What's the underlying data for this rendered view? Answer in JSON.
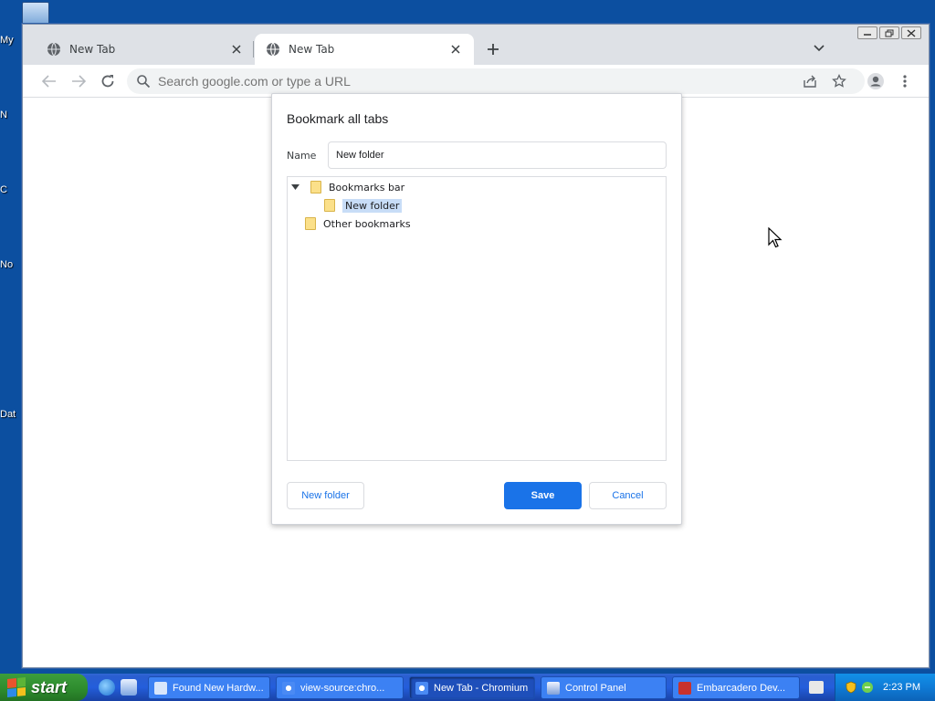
{
  "desktop": {
    "icon_labels": [
      "My",
      "N",
      "C",
      "No",
      "Dat"
    ]
  },
  "browser": {
    "tabs": [
      {
        "title": "New Tab",
        "active": false
      },
      {
        "title": "New Tab",
        "active": true
      }
    ],
    "omnibox": {
      "placeholder": "Search google.com or type a URL"
    }
  },
  "dialog": {
    "title": "Bookmark all tabs",
    "name_label": "Name",
    "name_value": "New folder",
    "tree": [
      {
        "label": "Bookmarks bar",
        "expanded": true
      },
      {
        "label": "New folder",
        "selected": true
      },
      {
        "label": "Other bookmarks"
      }
    ],
    "buttons": {
      "new_folder": "New folder",
      "save": "Save",
      "cancel": "Cancel"
    }
  },
  "taskbar": {
    "start_label": "start",
    "tasks": [
      {
        "label": "Found New Hardw...",
        "active": false
      },
      {
        "label": "view-source:chro...",
        "active": false
      },
      {
        "label": "New Tab - Chromium",
        "active": true
      },
      {
        "label": "Control Panel",
        "active": false
      },
      {
        "label": "Embarcadero Dev...",
        "active": false
      }
    ],
    "clock": "2:23 PM"
  },
  "colors": {
    "accent": "#1a73e8",
    "desktop": "#0c4fa0",
    "selection": "#c8ddf7",
    "folder": "#fbe08a"
  }
}
